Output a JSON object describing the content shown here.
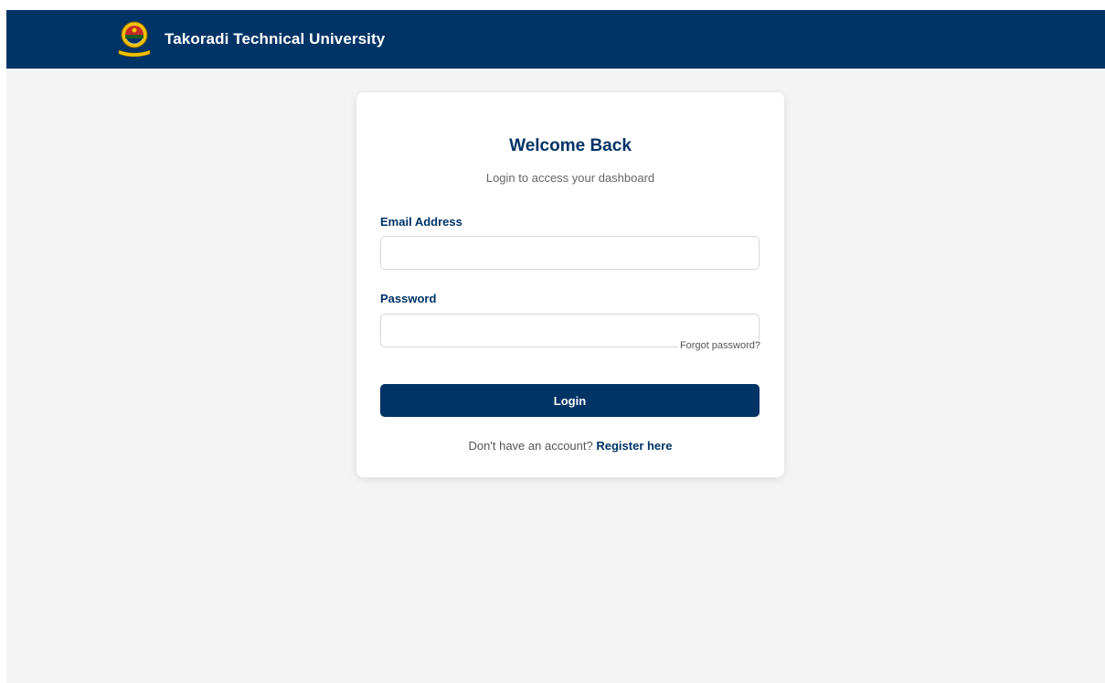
{
  "header": {
    "university_name": "Takoradi Technical University"
  },
  "login": {
    "title": "Welcome Back",
    "subtitle": "Login to access your dashboard",
    "email_label": "Email Address",
    "email_value": "",
    "password_label": "Password",
    "password_value": "",
    "forgot_password": "Forgot password?",
    "login_button": "Login",
    "register_prompt": "Don't have an account?",
    "register_link": "Register here"
  },
  "icons": {
    "logo": "university-crest-icon"
  },
  "colors": {
    "brand_navy": "#003366",
    "logo_gold": "#f2c200",
    "page_background": "#f4f4f4",
    "card_background": "#ffffff",
    "muted_text": "#666666"
  }
}
